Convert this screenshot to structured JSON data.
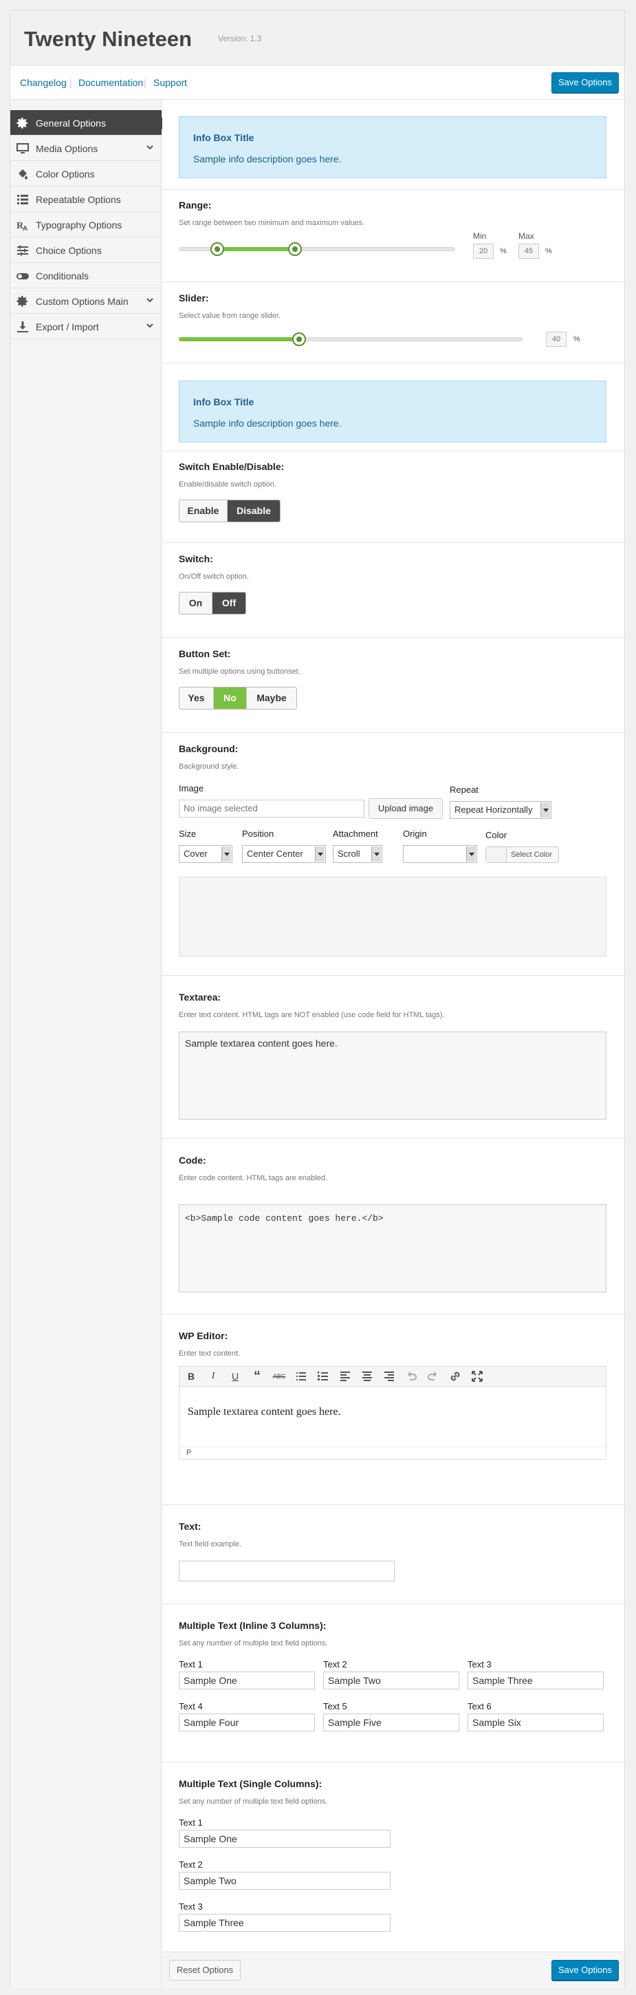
{
  "header": {
    "title": "Twenty Nineteen",
    "version": "Version: 1.3"
  },
  "topbar": {
    "links": [
      "Changelog",
      "Documentation",
      "Support"
    ],
    "save_label": "Save Options"
  },
  "sidebar": {
    "items": [
      {
        "label": "General Options",
        "icon": "gear-icon",
        "active": true
      },
      {
        "label": "Media Options",
        "icon": "monitor-icon",
        "chevron": true
      },
      {
        "label": "Color Options",
        "icon": "paint-bucket-icon"
      },
      {
        "label": "Repeatable Options",
        "icon": "list-icon"
      },
      {
        "label": "Typography Options",
        "icon": "typography-icon"
      },
      {
        "label": "Choice Options",
        "icon": "sliders-icon"
      },
      {
        "label": "Conditionals",
        "icon": "toggle-icon"
      },
      {
        "label": "Custom Options Main",
        "icon": "gear-icon",
        "chevron": true
      },
      {
        "label": "Export / Import",
        "icon": "download-icon",
        "chevron": true
      }
    ]
  },
  "info1": {
    "title": "Info Box Title",
    "desc": "Sample info description goes here."
  },
  "range": {
    "title": "Range:",
    "desc": "Set range between two minimum and maximum values.",
    "min_label": "Min",
    "max_label": "Max",
    "min": "20",
    "max": "45",
    "unit": "%",
    "min_fraction": 0.14,
    "max_fraction": 0.42
  },
  "slider": {
    "title": "Slider:",
    "desc": "Select value from range slider.",
    "value": "40",
    "unit": "%",
    "fraction": 0.35
  },
  "info2": {
    "title": "Info Box Title",
    "desc": "Sample info description goes here."
  },
  "switch_ed": {
    "title": "Switch Enable/Disable:",
    "desc": "Enable/disable switch option.",
    "on": "Enable",
    "off": "Disable"
  },
  "switch": {
    "title": "Switch:",
    "desc": "On/Off switch option.",
    "on": "On",
    "off": "Off"
  },
  "buttonset": {
    "title": "Button Set:",
    "desc": "Set multiple options using buttonset.",
    "options": [
      "Yes",
      "No",
      "Maybe"
    ],
    "selected": "No"
  },
  "background": {
    "title": "Background:",
    "desc": "Background style.",
    "image_label": "Image",
    "image_placeholder": "No image selected",
    "upload_label": "Upload image",
    "repeat_label": "Repeat",
    "repeat_value": "Repeat Horizontally",
    "size_label": "Size",
    "size_value": "Cover",
    "position_label": "Position",
    "position_value": "Center Center",
    "attachment_label": "Attachment",
    "attachment_value": "Scroll",
    "origin_label": "Origin",
    "origin_value": "",
    "color_label": "Color",
    "color_button": "Select Color"
  },
  "textarea": {
    "title": "Textarea:",
    "desc": "Enter text content. HTML tags are NOT enabled (use code field for HTML tags).",
    "value": "Sample textarea content goes here."
  },
  "code": {
    "title": "Code:",
    "desc": "Enter code content. HTML tags are enabled.",
    "value": "<b>Sample code content goes here.</b>"
  },
  "wpeditor": {
    "title": "WP Editor:",
    "desc": "Enter text content.",
    "content": "Sample textarea content goes here.",
    "path": "P"
  },
  "text": {
    "title": "Text:",
    "desc": "Text field example.",
    "value": ""
  },
  "multitext3": {
    "title": "Multiple Text (Inline 3 Columns):",
    "desc": "Set any number of multiple text field options.",
    "fields": [
      {
        "label": "Text 1",
        "value": "Sample One"
      },
      {
        "label": "Text 2",
        "value": "Sample Two"
      },
      {
        "label": "Text 3",
        "value": "Sample Three"
      },
      {
        "label": "Text 4",
        "value": "Sample Four"
      },
      {
        "label": "Text 5",
        "value": "Sample Five"
      },
      {
        "label": "Text 6",
        "value": "Sample Six"
      }
    ]
  },
  "multitext1": {
    "title": "Multiple Text (Single Columns):",
    "desc": "Set any number of multiple text field options.",
    "fields": [
      {
        "label": "Text 1",
        "value": "Sample One"
      },
      {
        "label": "Text 2",
        "value": "Sample Two"
      },
      {
        "label": "Text 3",
        "value": "Sample Three"
      }
    ]
  },
  "footer": {
    "reset_label": "Reset Options",
    "save_label": "Save Options"
  }
}
